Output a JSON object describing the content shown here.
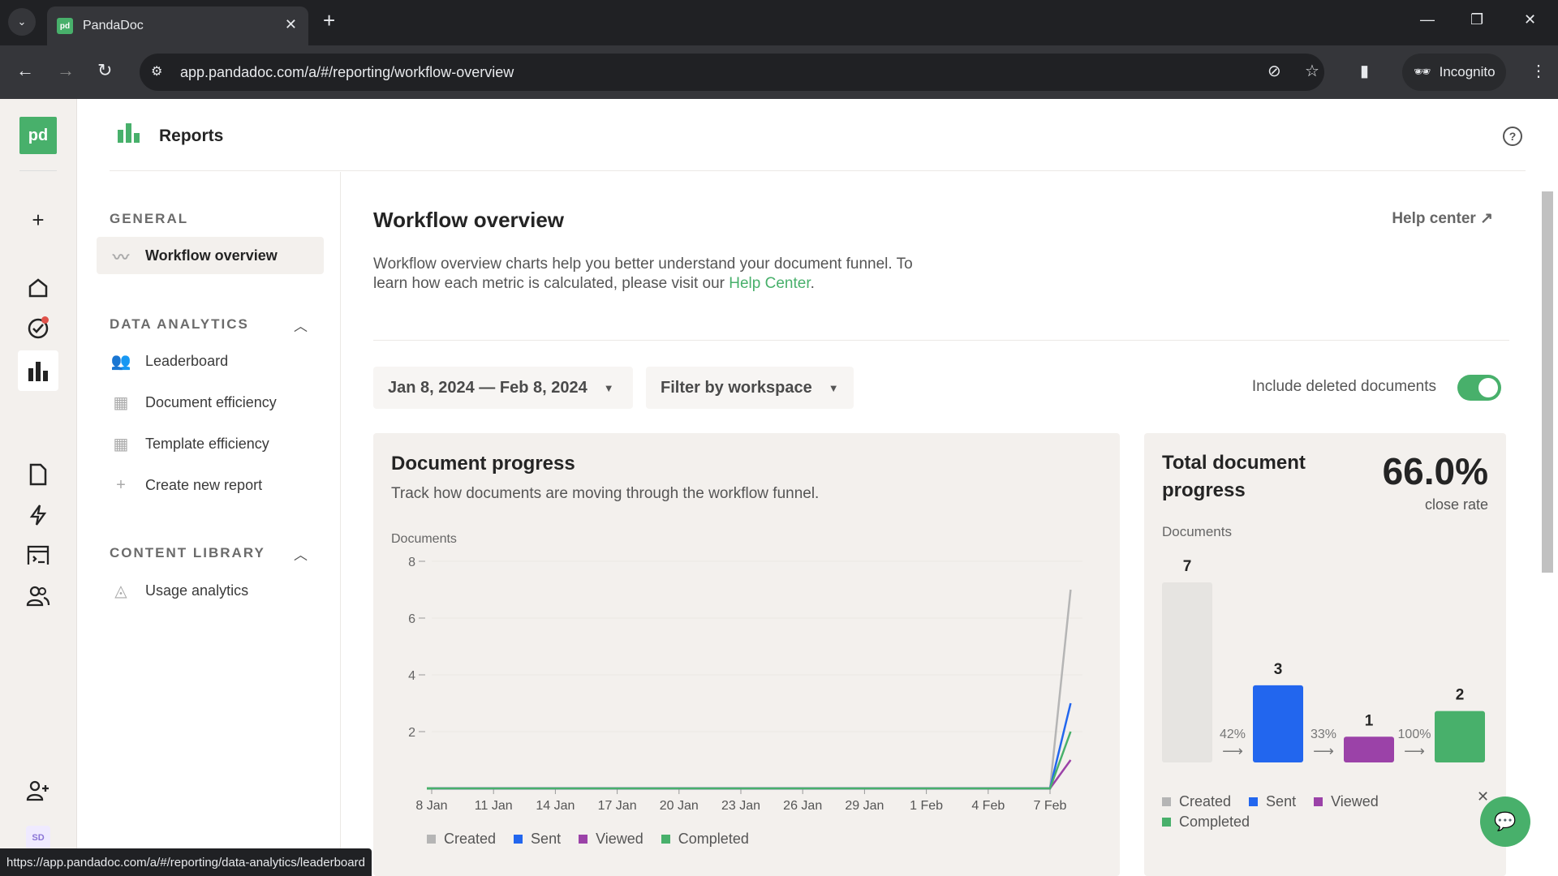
{
  "browser": {
    "tab_title": "PandaDoc",
    "url": "app.pandadoc.com/a/#/reporting/workflow-overview",
    "profile_label": "Incognito",
    "status_url": "https://app.pandadoc.com/a/#/reporting/data-analytics/leaderboard"
  },
  "rail": {
    "logo": "pd",
    "icons": [
      "plus-icon",
      "home-icon",
      "tasks-icon",
      "reports-icon",
      "document-icon",
      "automation-icon",
      "catalog-icon",
      "contacts-icon",
      "add-member-icon"
    ],
    "avatar": "SD"
  },
  "header": {
    "title": "Reports"
  },
  "nav": {
    "general_label": "GENERAL",
    "general_items": [
      {
        "label": "Workflow overview",
        "icon": "trend-icon",
        "active": true
      }
    ],
    "analytics_label": "DATA ANALYTICS",
    "analytics_items": [
      {
        "label": "Leaderboard",
        "icon": "users-icon"
      },
      {
        "label": "Document efficiency",
        "icon": "table-icon"
      },
      {
        "label": "Template efficiency",
        "icon": "table-icon"
      },
      {
        "label": "Create new report",
        "icon": "plus-icon"
      }
    ],
    "library_label": "CONTENT LIBRARY",
    "library_items": [
      {
        "label": "Usage analytics",
        "icon": "shapes-icon"
      }
    ]
  },
  "main": {
    "title": "Workflow overview",
    "help_center": "Help center",
    "description": "Workflow overview charts help you better understand your document funnel. To learn how each metric is calculated, please visit our ",
    "description_link": "Help Center",
    "description_end": ".",
    "date_range": "Jan 8, 2024 — Feb 8, 2024",
    "workspace_filter": "Filter by workspace",
    "toggle_label": "Include deleted documents",
    "toggle_on": true
  },
  "colors": {
    "created": "#b5b5b5",
    "sent": "#2266ee",
    "viewed": "#9b42a8",
    "completed": "#48b06b",
    "brand": "#48b06b"
  },
  "chart_data": [
    {
      "type": "line",
      "title": "Document progress",
      "subtitle": "Track how documents are moving through the workflow funnel.",
      "ylabel": "Documents",
      "xlabel": "",
      "ylim": [
        0,
        8
      ],
      "yticks": [
        2,
        4,
        6,
        8
      ],
      "x_ticks": [
        "8 Jan",
        "11 Jan",
        "14 Jan",
        "17 Jan",
        "20 Jan",
        "23 Jan",
        "26 Jan",
        "29 Jan",
        "1 Feb",
        "4 Feb",
        "7 Feb"
      ],
      "x_range_days": [
        0,
        31
      ],
      "series": [
        {
          "name": "Created",
          "color": "#b5b5b5",
          "points": [
            [
              0,
              0
            ],
            [
              30,
              0
            ],
            [
              31,
              7
            ]
          ]
        },
        {
          "name": "Sent",
          "color": "#2266ee",
          "points": [
            [
              0,
              0
            ],
            [
              30,
              0
            ],
            [
              31,
              3
            ]
          ]
        },
        {
          "name": "Viewed",
          "color": "#9b42a8",
          "points": [
            [
              0,
              0
            ],
            [
              30,
              0
            ],
            [
              31,
              1
            ]
          ]
        },
        {
          "name": "Completed",
          "color": "#48b06b",
          "points": [
            [
              0,
              0
            ],
            [
              30,
              0
            ],
            [
              31,
              2
            ]
          ]
        }
      ],
      "legend": [
        "Created",
        "Sent",
        "Viewed",
        "Completed"
      ],
      "legend_position": "bottom-left",
      "grid": true
    },
    {
      "type": "bar",
      "title": "Total document progress",
      "ylabel": "Documents",
      "close_rate": "66.0%",
      "close_rate_label": "close rate",
      "categories": [
        "Created",
        "Sent",
        "Viewed",
        "Completed"
      ],
      "values": [
        7,
        3,
        1,
        2
      ],
      "conversions": [
        "42%",
        "33%",
        "100%"
      ],
      "legend": [
        "Created",
        "Sent",
        "Viewed",
        "Completed"
      ],
      "legend_position": "bottom-left"
    }
  ]
}
